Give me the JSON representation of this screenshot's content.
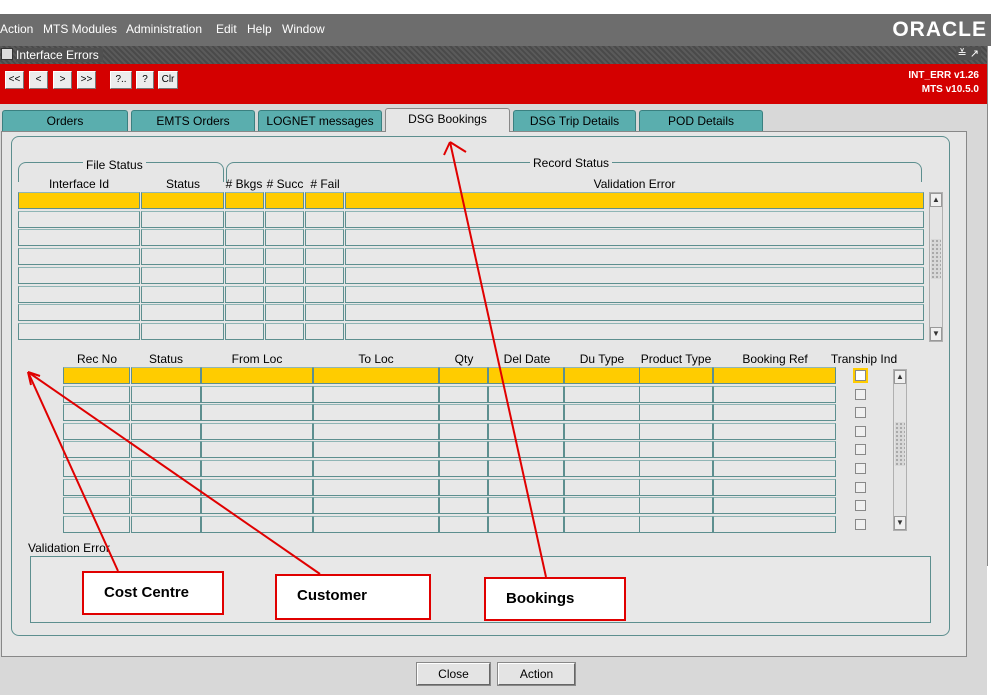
{
  "menubar": {
    "items": [
      "Action",
      "MTS Modules",
      "Administration",
      "Edit",
      "Help",
      "Window"
    ],
    "brand": "ORACLE"
  },
  "window": {
    "title": "Interface Errors",
    "controls": "≚ ↗"
  },
  "toolbar": {
    "buttons": [
      "<<",
      "<",
      ">",
      ">>",
      "?..",
      "?",
      "Clr"
    ],
    "form_version": "INT_ERR v1.26",
    "app_version": "MTS v10.5.0"
  },
  "tabs": [
    {
      "label": "Orders",
      "active": false
    },
    {
      "label": "EMTS Orders",
      "active": false
    },
    {
      "label": "LOGNET messages",
      "active": false
    },
    {
      "label": "DSG Bookings",
      "active": true
    },
    {
      "label": "DSG Trip Details",
      "active": false
    },
    {
      "label": "POD Details",
      "active": false
    }
  ],
  "file_status": {
    "title": "File Status",
    "columns": [
      "Interface Id",
      "Status"
    ]
  },
  "record_status": {
    "title": "Record Status",
    "columns": [
      "# Bkgs",
      "# Succ",
      "# Fail",
      "Validation Error"
    ]
  },
  "detail_grid": {
    "columns": [
      "Rec No",
      "Status",
      "From Loc",
      "To Loc",
      "Qty",
      "Del Date",
      "Du Type",
      "Product Type",
      "Booking Ref",
      "Tranship Ind"
    ]
  },
  "validation_error": {
    "label": "Validation Error",
    "value": ""
  },
  "buttons": {
    "close": "Close",
    "action": "Action"
  },
  "annotations": [
    "Cost Centre",
    "Customer",
    "Bookings"
  ],
  "colors": {
    "toolbar_red": "#d40000",
    "highlight_yellow": "#ffcc00",
    "tab_teal": "#5aaeae",
    "annotation_red": "#e00000"
  }
}
